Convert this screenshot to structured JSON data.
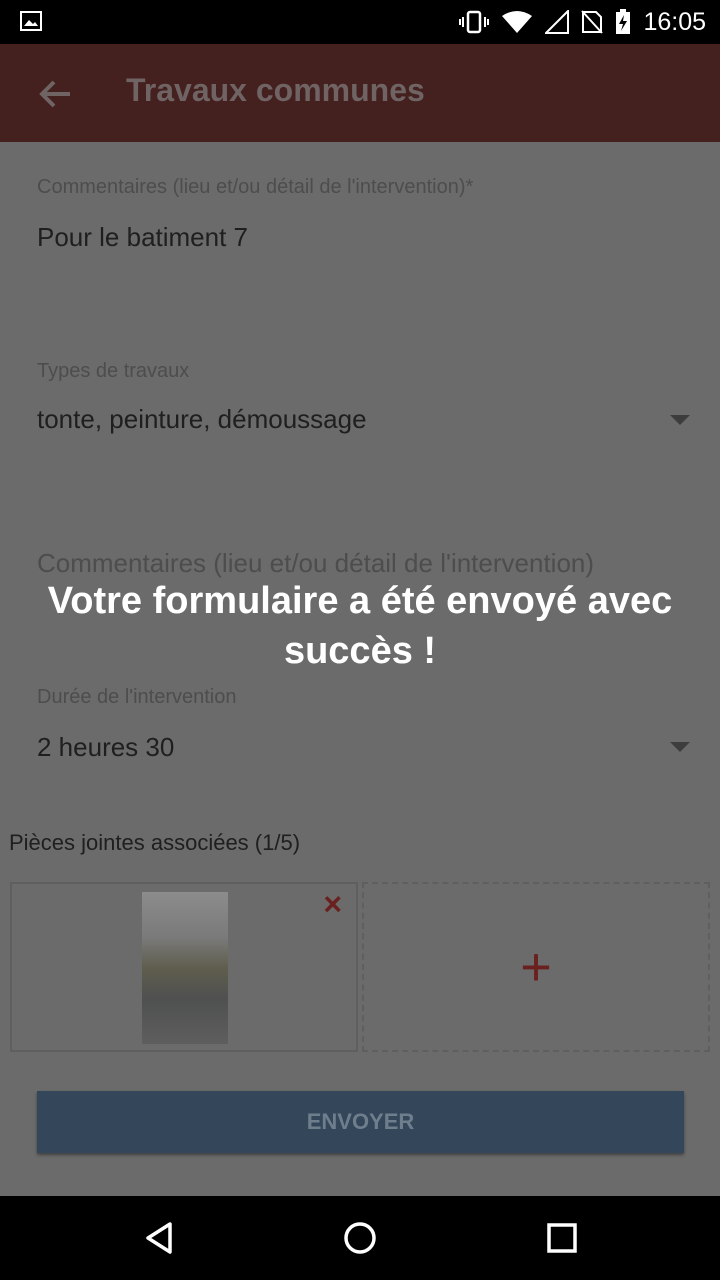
{
  "status": {
    "time": "16:05"
  },
  "toolbar": {
    "title": "Travaux communes"
  },
  "form": {
    "comment1_label": "Commentaires (lieu et/ou détail de l'intervention)*",
    "comment1_value": "Pour le batiment 7",
    "types_label": "Types de travaux",
    "types_value": "tonte, peinture, démoussage",
    "comment2_label": "Commentaires (lieu et/ou détail de l'intervention)",
    "duration_label": "Durée de l'intervention",
    "duration_value": "2 heures 30",
    "attachments_title": "Pièces jointes associées (1/5)",
    "remove_symbol": "×",
    "add_symbol": "+",
    "send_label": "ENVOYER"
  },
  "toast": {
    "line1": "Votre formulaire a été envoyé avec",
    "line2": "succès !"
  },
  "colors": {
    "toolbar": "#44201f",
    "accent": "#6b2020",
    "button": "#33465a"
  }
}
